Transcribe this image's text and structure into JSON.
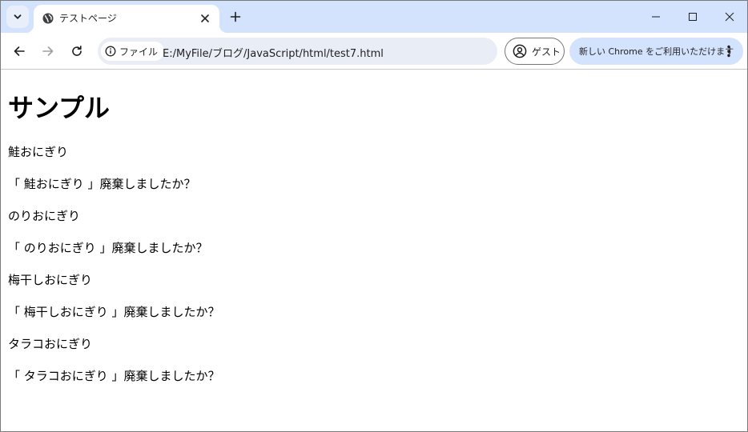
{
  "browser": {
    "tab": {
      "title": "テストページ"
    },
    "address_bar": {
      "site_chip_label": "ファイル",
      "url": "E:/MyFile/ブログ/JavaScript/html/test7.html"
    },
    "profile_label": "ゲスト",
    "promo_label": "新しい Chrome をご利用いただけます"
  },
  "page": {
    "heading": "サンプル",
    "paragraphs": [
      "鮭おにぎり",
      "「 鮭おにぎり 」廃棄しましたか？",
      "のりおにぎり",
      "「 のりおにぎり 」廃棄しましたか？",
      "梅干しおにぎり",
      "「 梅干しおにぎり 」廃棄しましたか？",
      "タラコおにぎり",
      "「 タラコおにぎり 」廃棄しましたか？"
    ]
  },
  "colors": {
    "tabstrip_bg": "#d3e3fd",
    "omnibox_bg": "#e9eef6",
    "promo_bg": "#d3e3fd"
  },
  "icons": {
    "tab_search": "chevron-down-icon",
    "favicon": "globe-icon",
    "tab_close": "close-icon",
    "new_tab": "plus-icon",
    "back": "arrow-left-icon",
    "forward": "arrow-right-icon",
    "reload": "reload-icon",
    "site_info": "info-icon",
    "profile": "account-circle-icon",
    "menu": "more-vert-icon",
    "minimize": "minimize-icon",
    "maximize": "maximize-icon",
    "window_close": "window-close-icon"
  }
}
